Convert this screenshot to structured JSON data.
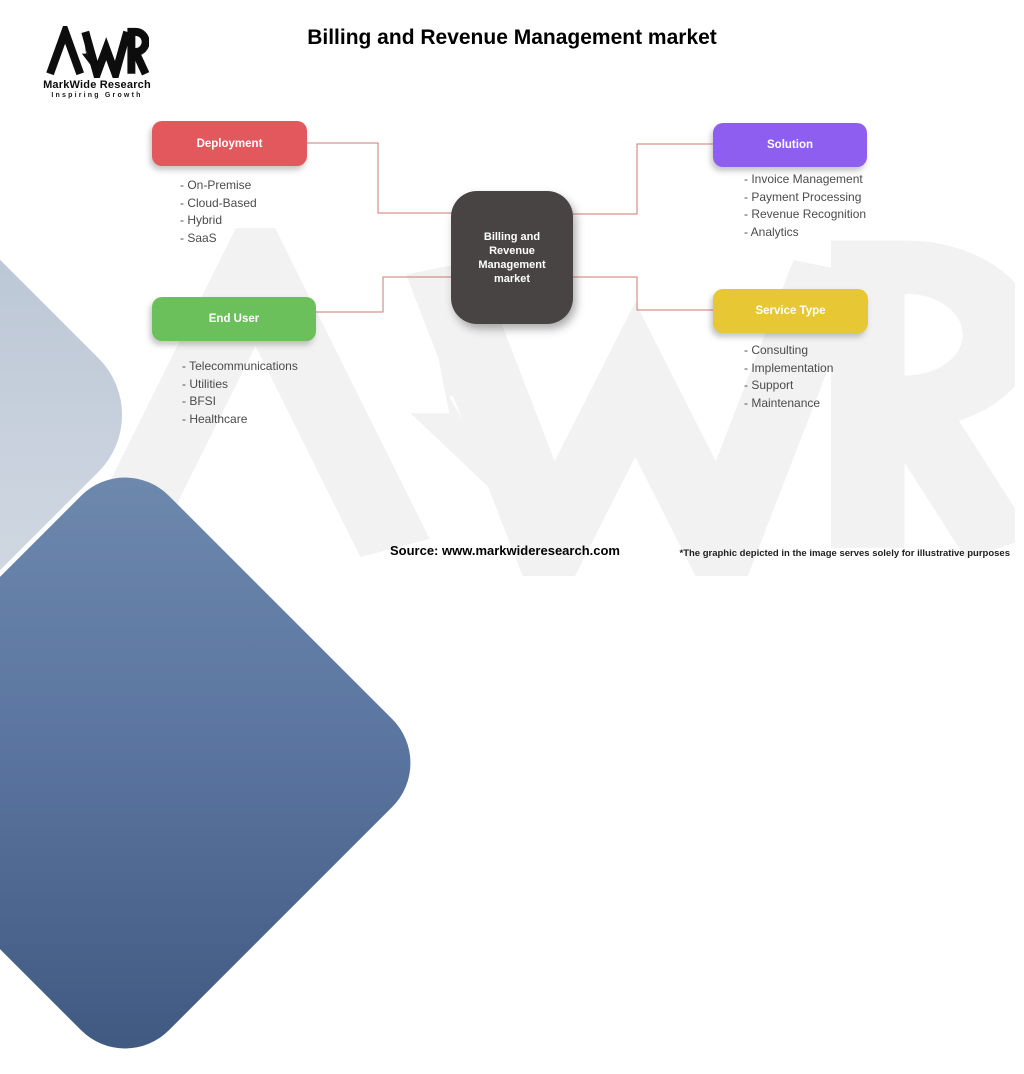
{
  "logo": {
    "brand_mark": "MWR",
    "brand_name": "MarkWide Research",
    "tagline": "Inspiring Growth"
  },
  "header": {
    "title": "Billing and Revenue Management market"
  },
  "diagram": {
    "center_node": {
      "label": "Billing and Revenue Management market"
    },
    "nodes": [
      {
        "id": "deployment",
        "label": "Deployment",
        "color": "#e2585c",
        "items": [
          "- On-Premise",
          "- Cloud-Based",
          "- Hybrid",
          "- SaaS"
        ]
      },
      {
        "id": "solution",
        "label": "Solution",
        "color": "#8e5ef1",
        "items": [
          "- Invoice Management",
          "- Payment Processing",
          "- Revenue Recognition",
          "- Analytics"
        ]
      },
      {
        "id": "end-user",
        "label": "End User",
        "color": "#6cc05b",
        "items": [
          "- Telecommunications",
          "- Utilities",
          "- BFSI",
          "- Healthcare"
        ]
      },
      {
        "id": "service-type",
        "label": "Service Type",
        "color": "#e7c733",
        "items": [
          "- Consulting",
          "- Implementation",
          "- Support",
          "- Maintenance"
        ]
      }
    ],
    "connector_color": "#cf7a72",
    "center_node_color": "#484444"
  },
  "footer": {
    "source": "Source: www.markwideresearch.com",
    "disclaimer": "*The graphic depicted in the image serves solely for illustrative purposes"
  },
  "colors": {
    "watermark": "#f2f2f2",
    "accent_shape_light": "#c0cbd9",
    "accent_shape_dark": "#55709a"
  }
}
